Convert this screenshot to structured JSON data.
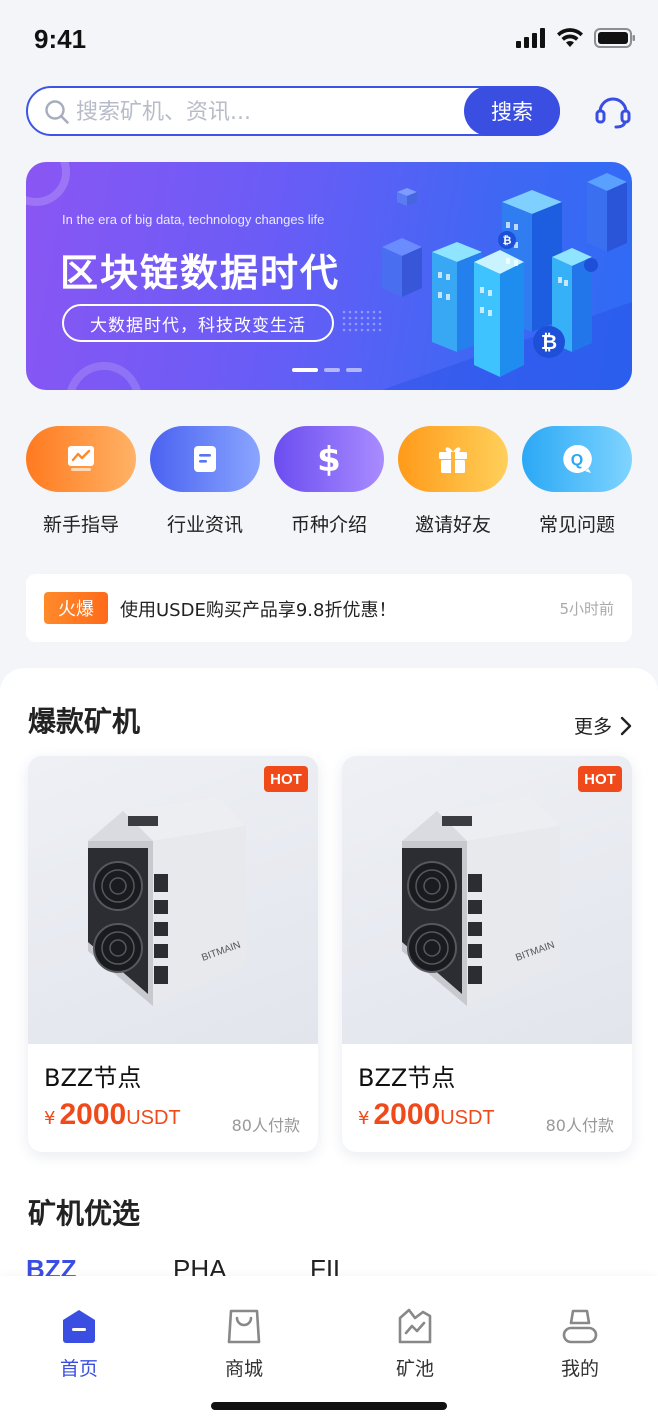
{
  "status_bar": {
    "time": "9:41"
  },
  "search": {
    "placeholder": "搜索矿机、资讯...",
    "button_label": "搜索"
  },
  "banner": {
    "subtitle": "In the era of big data, technology changes life",
    "title": "区块链数据时代",
    "pill": "大数据时代，科技改变生活",
    "slide_count": 3,
    "active_slide": 1
  },
  "quick_nav": [
    {
      "label": "新手指导",
      "icon": "chart-icon"
    },
    {
      "label": "行业资讯",
      "icon": "news-icon"
    },
    {
      "label": "币种介绍",
      "icon": "dollar-icon"
    },
    {
      "label": "邀请好友",
      "icon": "gift-icon"
    },
    {
      "label": "常见问题",
      "icon": "question-icon"
    }
  ],
  "notice": {
    "badge": "火爆",
    "text": "使用USDE购买产品享9.8折优惠！",
    "time": "5小时前"
  },
  "hot_section": {
    "title": "爆款矿机",
    "more_label": "更多"
  },
  "products": [
    {
      "badge": "HOT",
      "name": "BZZ节点",
      "currency_symbol": "¥",
      "price": "2000",
      "unit": "USDT",
      "paid": "80人付款",
      "brand": "BITMAIN"
    },
    {
      "badge": "HOT",
      "name": "BZZ节点",
      "currency_symbol": "¥",
      "price": "2000",
      "unit": "USDT",
      "paid": "80人付款",
      "brand": "BITMAIN"
    }
  ],
  "select_section": {
    "title": "矿机优选",
    "tabs": [
      "BZZ",
      "PHA",
      "FIL"
    ],
    "active_tab": 0
  },
  "tab_bar": [
    {
      "label": "首页",
      "icon": "home-icon",
      "active": true
    },
    {
      "label": "商城",
      "icon": "shopping-bag-icon",
      "active": false
    },
    {
      "label": "矿池",
      "icon": "pool-chart-icon",
      "active": false
    },
    {
      "label": "我的",
      "icon": "user-icon",
      "active": false
    }
  ],
  "colors": {
    "primary": "#3a4fe2",
    "accent": "#f04a1a",
    "background": "#f3f5f9"
  }
}
